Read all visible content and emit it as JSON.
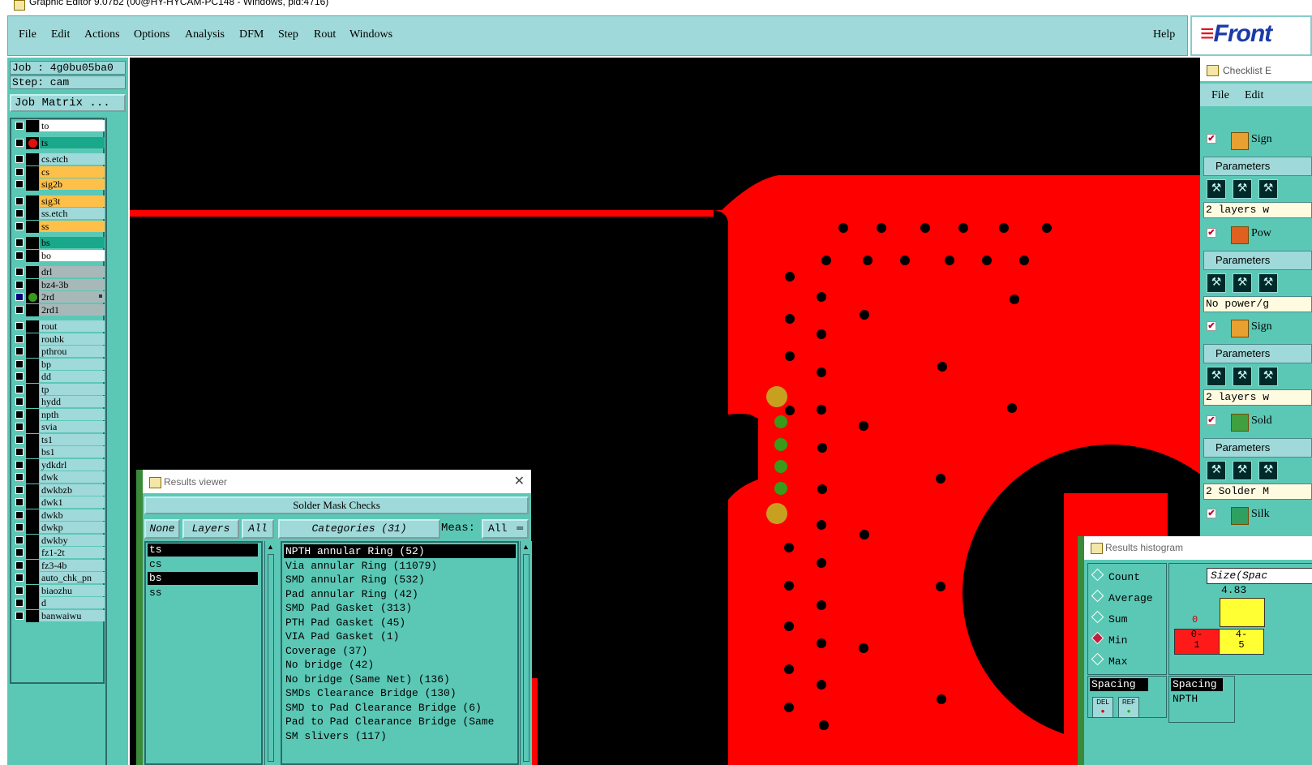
{
  "window": {
    "title": "Graphic Editor 9.07b2 (00@HY-HYCAM-PC148 - Windows, pid:4716)"
  },
  "menu": {
    "items": [
      "File",
      "Edit",
      "Actions",
      "Options",
      "Analysis",
      "DFM",
      "Step",
      "Rout",
      "Windows"
    ],
    "help": "Help"
  },
  "logo": {
    "prefix": "≡",
    "text": "Front"
  },
  "job": {
    "job_label": "Job : 4g0bu05ba0",
    "step_label": "Step: cam",
    "matrix_button": "Job Matrix ..."
  },
  "layers": [
    {
      "name": "to",
      "bg": "#ffffff",
      "dot": ""
    },
    {
      "name": "ts",
      "bg": "#1aa88a",
      "dot": "#e01010"
    },
    {
      "name": "cs.etch",
      "bg": "#9fd9d9",
      "dot": ""
    },
    {
      "name": "cs",
      "bg": "#ffc04a",
      "dot": ""
    },
    {
      "name": "sig2b",
      "bg": "#ffc04a",
      "dot": ""
    },
    {
      "name": "sig3t",
      "bg": "#ffc04a",
      "dot": ""
    },
    {
      "name": "ss.etch",
      "bg": "#9fd9d9",
      "dot": ""
    },
    {
      "name": "ss",
      "bg": "#ffc04a",
      "dot": ""
    },
    {
      "name": "bs",
      "bg": "#1aa88a",
      "dot": ""
    },
    {
      "name": "bo",
      "bg": "#ffffff",
      "dot": ""
    },
    {
      "name": "drl",
      "bg": "#a8b8b8",
      "dot": ""
    },
    {
      "name": "bz4-3b",
      "bg": "#a8b8b8",
      "dot": ""
    },
    {
      "name": "2rd",
      "bg": "#a8b8b8",
      "dot": "#3a9a1a"
    },
    {
      "name": "2rd1",
      "bg": "#a8b8b8",
      "dot": ""
    },
    {
      "name": "rout",
      "bg": "#9fd9d9",
      "dot": ""
    },
    {
      "name": "roubk",
      "bg": "#9fd9d9",
      "dot": ""
    },
    {
      "name": "pthrou",
      "bg": "#9fd9d9",
      "dot": ""
    },
    {
      "name": "bp",
      "bg": "#9fd9d9",
      "dot": ""
    },
    {
      "name": "dd",
      "bg": "#9fd9d9",
      "dot": ""
    },
    {
      "name": "tp",
      "bg": "#9fd9d9",
      "dot": ""
    },
    {
      "name": "hydd",
      "bg": "#9fd9d9",
      "dot": ""
    },
    {
      "name": "npth",
      "bg": "#9fd9d9",
      "dot": ""
    },
    {
      "name": "svia",
      "bg": "#9fd9d9",
      "dot": ""
    },
    {
      "name": "ts1",
      "bg": "#9fd9d9",
      "dot": ""
    },
    {
      "name": "bs1",
      "bg": "#9fd9d9",
      "dot": ""
    },
    {
      "name": "ydkdrl",
      "bg": "#9fd9d9",
      "dot": ""
    },
    {
      "name": "dwk",
      "bg": "#9fd9d9",
      "dot": ""
    },
    {
      "name": "dwkbzb",
      "bg": "#9fd9d9",
      "dot": ""
    },
    {
      "name": "dwk1",
      "bg": "#9fd9d9",
      "dot": ""
    },
    {
      "name": "dwkb",
      "bg": "#9fd9d9",
      "dot": ""
    },
    {
      "name": "dwkp",
      "bg": "#9fd9d9",
      "dot": ""
    },
    {
      "name": "dwkby",
      "bg": "#9fd9d9",
      "dot": ""
    },
    {
      "name": "fz1-2t",
      "bg": "#9fd9d9",
      "dot": ""
    },
    {
      "name": "fz3-4b",
      "bg": "#9fd9d9",
      "dot": ""
    },
    {
      "name": "auto_chk_pn",
      "bg": "#9fd9d9",
      "dot": ""
    },
    {
      "name": "biaozhu",
      "bg": "#9fd9d9",
      "dot": ""
    },
    {
      "name": "d",
      "bg": "#9fd9d9",
      "dot": ""
    },
    {
      "name": "banwaiwu",
      "bg": "#9fd9d9",
      "dot": ""
    }
  ],
  "checklist": {
    "title": "Checklist E",
    "menu": [
      "File",
      "Edit"
    ],
    "rows": [
      {
        "label": "Sign",
        "param": "Parameters",
        "status": "2 layers w"
      },
      {
        "label": "Pow",
        "param": "Parameters",
        "status": "No power/g"
      },
      {
        "label": "Sign",
        "param": "Parameters",
        "status": "2 layers w"
      },
      {
        "label": "Sold",
        "param": "Parameters",
        "status": "2 Solder M"
      },
      {
        "label": "Silk",
        "param": "",
        "status": ""
      }
    ]
  },
  "results_viewer": {
    "title": "Results viewer",
    "header": "Solder Mask Checks",
    "btn_none": "None",
    "btn_layers": "Layers",
    "btn_all": "All",
    "btn_categories": "Categories (31)",
    "meas_label": "Meas:",
    "meas_value": "All",
    "layers": [
      "ts",
      "cs",
      "bs",
      "ss"
    ],
    "categories": [
      "NPTH annular Ring (52)",
      "Via annular Ring (11079)",
      "SMD annular Ring (532)",
      "Pad annular Ring (42)",
      "SMD Pad Gasket (313)",
      "PTH Pad Gasket (45)",
      "VIA Pad Gasket (1)",
      "Coverage (37)",
      "No bridge (42)",
      "No bridge (Same Net) (136)",
      "SMDs Clearance Bridge (130)",
      "SMD to Pad Clearance Bridge (6)",
      "Pad to Pad Clearance Bridge (Same",
      "SM slivers (117)"
    ]
  },
  "histogram": {
    "title": "Results histogram",
    "modes": [
      "Count",
      "Average",
      "Sum",
      "Min",
      "Max"
    ],
    "selected_mode": "Min",
    "size_label": "Size(Spac",
    "max_value": "4.83",
    "zero_label": "0",
    "bin1": "0-\n1",
    "bin2": "4-\n5",
    "sel_label": "Spacing",
    "sel2_label": "Spacing",
    "sel2_name": "NPTH",
    "btn_del": "DEL",
    "btn_ref": "REF"
  }
}
